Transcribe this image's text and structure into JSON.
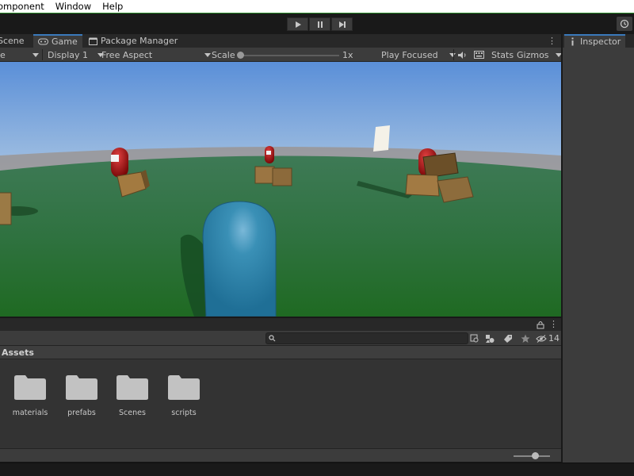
{
  "menu": {
    "items": [
      "omponent",
      "Window",
      "Help"
    ]
  },
  "toolbar": {
    "play_icon": "play-icon",
    "pause_icon": "pause-icon",
    "step_icon": "step-icon",
    "history_icon": "history-icon"
  },
  "tabs": [
    {
      "label": "Scene",
      "icon": "scene-icon",
      "active": false
    },
    {
      "label": "Game",
      "icon": "gamepad-icon",
      "active": true
    },
    {
      "label": "Package Manager",
      "icon": "package-icon",
      "active": false
    }
  ],
  "game_toolbar": {
    "mode_label": "e",
    "display_label": "Display 1",
    "aspect_label": "Free Aspect",
    "scale_label": "Scale",
    "scale_value": "1x",
    "scale_fraction": 0.0,
    "play_mode_label": "Play Focused",
    "stats_label": "Stats",
    "gizmos_label": "Gizmos"
  },
  "project": {
    "hidden_count": "14",
    "assets_title": "Assets",
    "folders": [
      {
        "name": "materials"
      },
      {
        "name": "prefabs"
      },
      {
        "name": "Scenes"
      },
      {
        "name": "scripts"
      }
    ],
    "zoom_fraction": 0.6
  },
  "inspector": {
    "tab_label": "Inspector"
  },
  "colors": {
    "accent": "#3a79bb",
    "panel": "#3c3c3c",
    "background": "#191919",
    "ground": "#2a7a3c",
    "player_capsule": "#2f8fb2",
    "enemy_capsule": "#b01515",
    "crate": "#9a7440"
  }
}
